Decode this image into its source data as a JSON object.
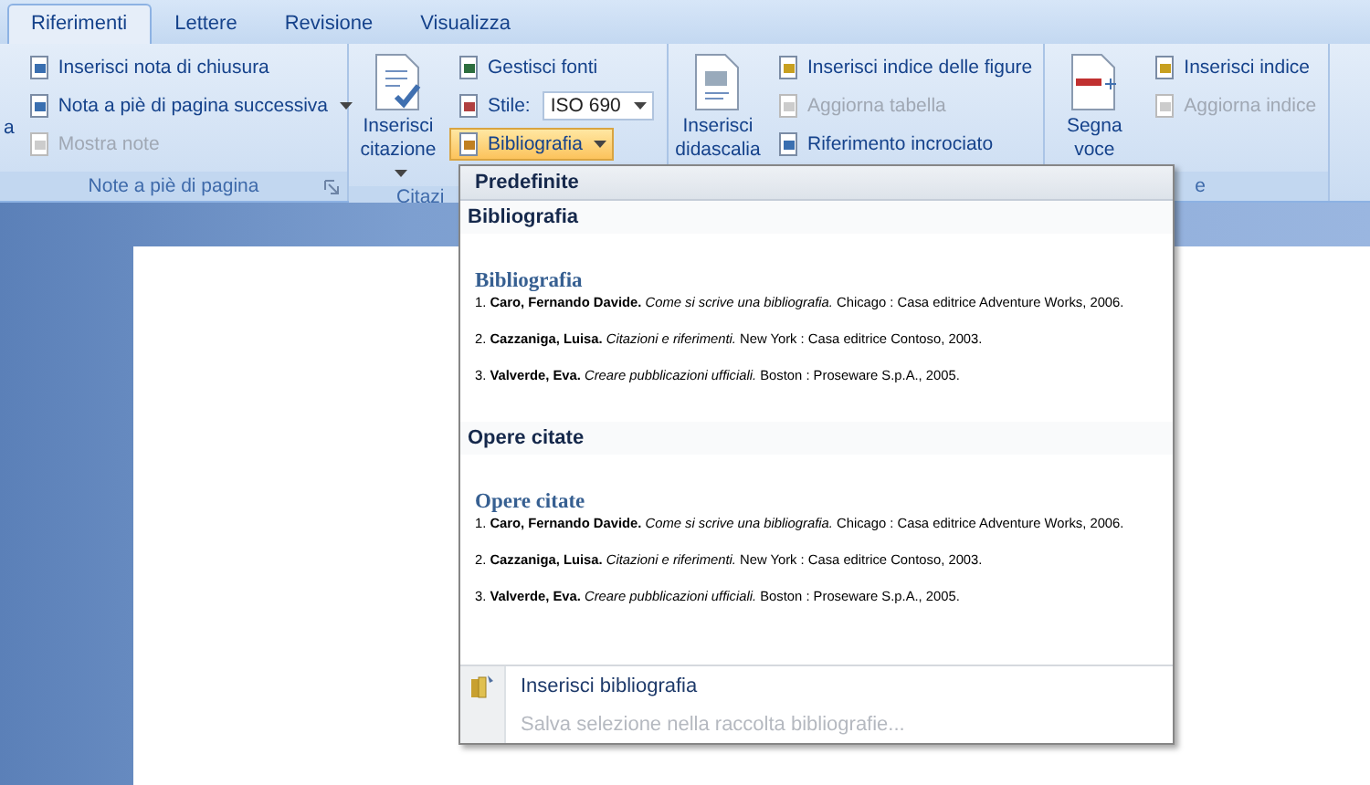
{
  "tabs": [
    {
      "label": "Riferimenti",
      "selected": true
    },
    {
      "label": "Lettere",
      "selected": false
    },
    {
      "label": "Revisione",
      "selected": false
    },
    {
      "label": "Visualizza",
      "selected": false
    }
  ],
  "ribbon": {
    "groups": [
      {
        "label": "Note a piè di pagina",
        "large_buttons": [
          {
            "label": "a",
            "dropdown": false
          }
        ],
        "small_buttons": [
          {
            "label": "Inserisci nota di chiusura",
            "disabled": false,
            "dropdown": false,
            "expanded": false
          },
          {
            "label": "Nota a piè di pagina successiva",
            "disabled": false,
            "dropdown": true,
            "expanded": false
          },
          {
            "label": "Mostra note",
            "disabled": true,
            "dropdown": false,
            "expanded": false
          }
        ]
      },
      {
        "label": "Citazi",
        "large_buttons": [
          {
            "label": "Inserisci citazione",
            "dropdown": true
          }
        ],
        "small_buttons": [
          {
            "label": "Gestisci fonti",
            "disabled": false,
            "dropdown": false,
            "expanded": false
          },
          {
            "label": "Stile:",
            "disabled": false,
            "dropdown": false,
            "expanded": false,
            "value": "ISO 690"
          },
          {
            "label": "Bibliografia",
            "disabled": false,
            "dropdown": true,
            "expanded": true
          }
        ]
      },
      {
        "large_buttons": [
          {
            "label": "Inserisci didascalia",
            "dropdown": false
          }
        ],
        "small_buttons": [
          {
            "label": "Inserisci indice delle figure",
            "disabled": false,
            "dropdown": false,
            "expanded": false
          },
          {
            "label": "Aggiorna tabella",
            "disabled": true,
            "dropdown": false,
            "expanded": false
          },
          {
            "label": "Riferimento incrociato",
            "disabled": false,
            "dropdown": false,
            "expanded": false
          }
        ]
      },
      {
        "label": "e",
        "large_buttons": [
          {
            "label": "Segna voce",
            "dropdown": false
          }
        ],
        "small_buttons": [
          {
            "label": "Inserisci indice",
            "disabled": false,
            "dropdown": false,
            "expanded": false
          },
          {
            "label": "Aggiorna indice",
            "disabled": true,
            "dropdown": false,
            "expanded": false
          }
        ]
      }
    ]
  },
  "dropdown": {
    "header": "Predefinite",
    "sections": [
      {
        "title": "Bibliografia",
        "heading": "Bibliografia",
        "entries": [
          "1. **Caro, Fernando Davide.** *Come si scrive una bibliografia.* Chicago : Casa editrice Adventure Works, 2006.",
          "2. **Cazzaniga, Luisa.** *Citazioni e riferimenti.* New York : Casa editrice Contoso, 2003.",
          "3. **Valverde, Eva.** *Creare pubblicazioni ufficiali.* Boston : Proseware S.p.A., 2005."
        ]
      },
      {
        "title": "Opere citate",
        "heading": "Opere citate",
        "entries": [
          "1. **Caro, Fernando Davide.** *Come si scrive una bibliografia.* Chicago : Casa editrice Adventure Works, 2006.",
          "2. **Cazzaniga, Luisa.** *Citazioni e riferimenti.* New York : Casa editrice Contoso, 2003.",
          "3. **Valverde, Eva.** *Creare pubblicazioni ufficiali.* Boston : Proseware S.p.A., 2005."
        ]
      }
    ],
    "actions": [
      {
        "label": "Inserisci bibliografia",
        "disabled": false
      },
      {
        "label": "Salva selezione nella raccolta bibliografie...",
        "disabled": true
      }
    ]
  }
}
